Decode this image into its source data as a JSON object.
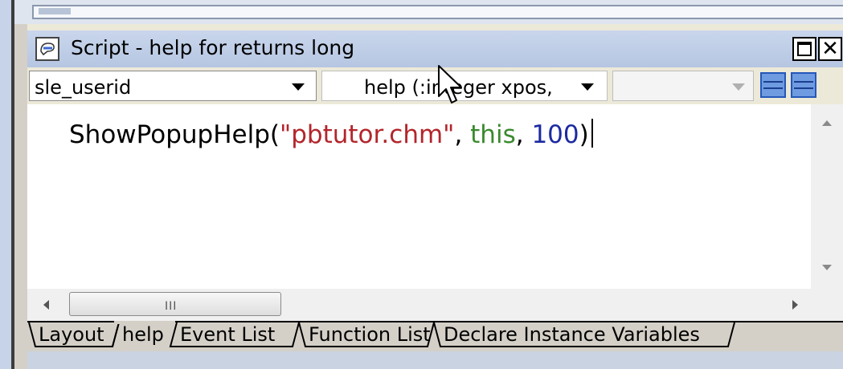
{
  "window": {
    "title": "Script - help for  returns long"
  },
  "toolbar": {
    "object_dropdown": "sle_userid",
    "event_dropdown": "help (:integer xpos,",
    "ancestor_dropdown": ""
  },
  "code": {
    "fn": "ShowPopupHelp(",
    "str": "\"pbtutor.chm\"",
    "sep1": ", ",
    "kw": "this",
    "sep2": ", ",
    "num": "100",
    "close": ")"
  },
  "scrollbar": {
    "grip": "III"
  },
  "tabs": [
    "Layout",
    "help",
    "Event List",
    "Function List",
    "Declare Instance Variables"
  ],
  "active_tab": "help",
  "colors": {
    "string": "#b3252b",
    "keyword": "#3a8a2e",
    "number": "#1c2aa0"
  },
  "icons": [
    "script-icon",
    "maximize-icon",
    "close-icon",
    "dropdown-arrow-icon",
    "layout-button-icon",
    "mouse-cursor-icon"
  ]
}
